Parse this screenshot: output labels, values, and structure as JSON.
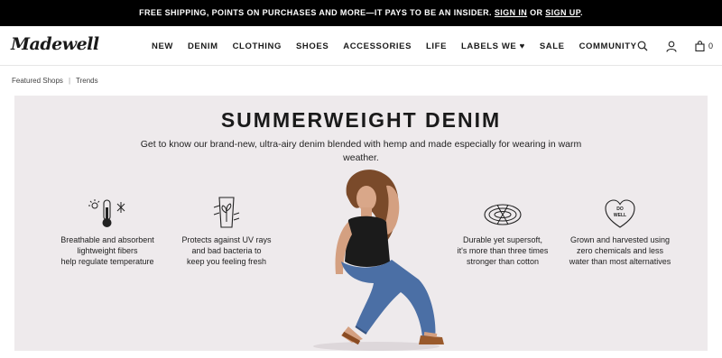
{
  "promo": {
    "text": "FREE SHIPPING, POINTS ON PURCHASES AND MORE—IT PAYS TO BE AN INSIDER.",
    "sign_in": "SIGN IN",
    "or": "OR",
    "sign_up": "SIGN UP",
    "end": "."
  },
  "header": {
    "logo": "Madewell",
    "nav": [
      "NEW",
      "DENIM",
      "CLOTHING",
      "SHOES",
      "ACCESSORIES",
      "LIFE",
      "LABELS WE ♥",
      "SALE",
      "COMMUNITY"
    ],
    "cart_count": "0",
    "icons": [
      "search-icon",
      "account-icon",
      "bag-icon"
    ]
  },
  "breadcrumb": {
    "items": [
      "Featured Shops",
      "Trends"
    ],
    "separator": "|"
  },
  "hero": {
    "title": "SUMMERWEIGHT DENIM",
    "subtitle": "Get to know our brand-new, ultra-airy denim blended with hemp and made especially for wearing in warm weather.",
    "features": [
      {
        "icon": "thermometer-icon",
        "lines": [
          "Breathable and absorbent",
          "lightweight fibers",
          "help regulate temperature"
        ]
      },
      {
        "icon": "plant-glass-icon",
        "lines": [
          "Protects against UV rays",
          "and bad bacteria to",
          "keep you feeling fresh"
        ]
      },
      {
        "icon": "rope-icon",
        "lines": [
          "Durable yet supersoft,",
          "it's more than three times",
          "stronger than cotton"
        ]
      },
      {
        "icon": "do-well-heart-icon",
        "lines": [
          "Grown and harvested using",
          "zero chemicals and less",
          "water than most alternatives"
        ]
      }
    ],
    "badge_text": "DO WELL",
    "background": "#eeeaec"
  }
}
